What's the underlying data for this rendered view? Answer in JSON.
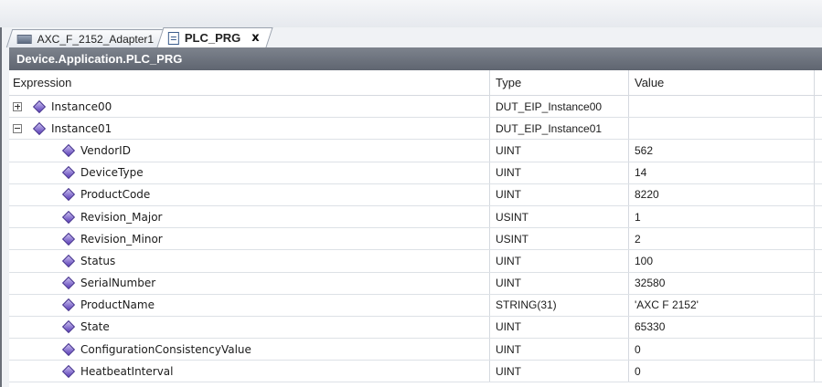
{
  "tabs": [
    {
      "label": "AXC_F_2152_Adapter1",
      "icon": "device-icon",
      "active": false
    },
    {
      "label": "PLC_PRG",
      "icon": "document-icon",
      "active": true,
      "close": "x"
    }
  ],
  "title_bar": "Device.Application.PLC_PRG",
  "columns": {
    "expression": "Expression",
    "type": "Type",
    "value": "Value"
  },
  "rows": [
    {
      "name": "Instance00",
      "type": "DUT_EIP_Instance00",
      "value": "",
      "expander": "plus",
      "level": 0
    },
    {
      "name": "Instance01",
      "type": "DUT_EIP_Instance01",
      "value": "",
      "expander": "minus",
      "level": 0
    },
    {
      "name": "VendorID",
      "type": "UINT",
      "value": "562",
      "level": 1
    },
    {
      "name": "DeviceType",
      "type": "UINT",
      "value": "14",
      "level": 1
    },
    {
      "name": "ProductCode",
      "type": "UINT",
      "value": "8220",
      "level": 1
    },
    {
      "name": "Revision_Major",
      "type": "USINT",
      "value": "1",
      "level": 1
    },
    {
      "name": "Revision_Minor",
      "type": "USINT",
      "value": "2",
      "level": 1
    },
    {
      "name": "Status",
      "type": "UINT",
      "value": "100",
      "level": 1
    },
    {
      "name": "SerialNumber",
      "type": "UINT",
      "value": "32580",
      "level": 1
    },
    {
      "name": "ProductName",
      "type": "STRING(31)",
      "value": "'AXC F 2152'",
      "level": 1
    },
    {
      "name": "State",
      "type": "UINT",
      "value": "65330",
      "level": 1
    },
    {
      "name": "ConfigurationConsistencyValue",
      "type": "UINT",
      "value": "0",
      "level": 1
    },
    {
      "name": "HeatbeatInterval",
      "type": "UINT",
      "value": "0",
      "level": 1
    }
  ],
  "colors": {
    "title_bar": "#6b717b",
    "variable_icon": "#5b3fb8"
  }
}
